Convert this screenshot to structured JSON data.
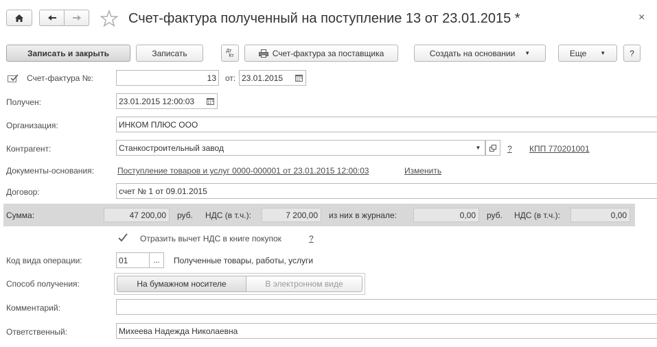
{
  "window": {
    "title": "Счет-фактура полученный на поступление 13 от 23.01.2015 *",
    "close_glyph": "×"
  },
  "toolbar": {
    "save_close_label": "Записать и закрыть",
    "save_label": "Записать",
    "dtkt_top": "Дт",
    "dtkt_bottom": "Кт",
    "supplier_invoice_label": "Счет-фактура за поставщика",
    "create_based_label": "Создать на основании",
    "more_label": "Еще",
    "help_label": "?"
  },
  "form": {
    "invoice_label": "Счет-фактура №:",
    "invoice_number": "13",
    "from_label": "от:",
    "invoice_date": "23.01.2015",
    "received_label": "Получен:",
    "received_value": "23.01.2015 12:00:03",
    "org_label": "Организация:",
    "org_value": "ИНКОМ ПЛЮС ООО",
    "counterparty_label": "Контрагент:",
    "counterparty_value": "Станкостроительный завод",
    "counterparty_help": "?",
    "kpp_link": "КПП 770201001",
    "base_docs_label": "Документы-основания:",
    "base_docs_link": "Поступление товаров и услуг 0000-000001 от 23.01.2015 12:00:03",
    "change_link": "Изменить",
    "contract_label": "Договор:",
    "contract_value": "счет № 1 от 09.01.2015",
    "sum_label": "Сумма:",
    "sum_value": "47 200,00",
    "rub1": "руб.",
    "vat_label1": "НДС (в т.ч.):",
    "vat_value1": "7 200,00",
    "journal_label": "из них в журнале:",
    "journal_value": "0,00",
    "rub2": "руб.",
    "vat_label2": "НДС (в т.ч.):",
    "vat_value2": "0,00",
    "reflect_vat_label": "Отразить вычет НДС в книге покупок",
    "reflect_vat_help": "?",
    "op_code_label": "Код вида операции:",
    "op_code_value": "01",
    "op_code_pick": "...",
    "op_code_desc": "Полученные товары, работы, услуги",
    "receive_method_label": "Способ получения:",
    "method_paper": "На бумажном носителе",
    "method_electronic": "В электронном виде",
    "comment_label": "Комментарий:",
    "comment_value": "",
    "responsible_label": "Ответственный:",
    "responsible_value": "Михеева Надежда Николаевна"
  },
  "colors": {
    "sum_band": "#d8d8d8",
    "grey_input": "#e6e6e6"
  }
}
